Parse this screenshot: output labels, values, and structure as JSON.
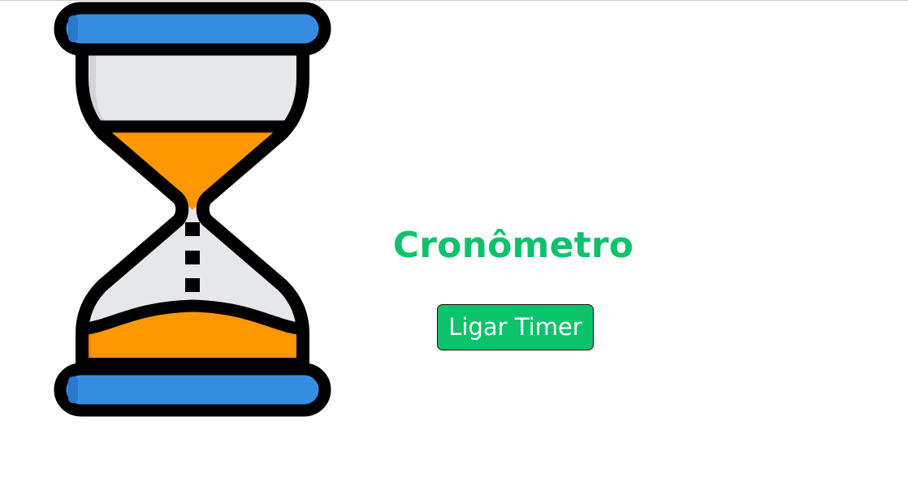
{
  "page": {
    "title": "Cronômetro"
  },
  "controls": {
    "start_button_label": "Ligar Timer"
  },
  "icons": {
    "hero": "hourglass-icon"
  },
  "colors": {
    "accent": "#0cc36b",
    "hourglass_caps": "#368ee3",
    "hourglass_sand": "#ff9700",
    "hourglass_glass": "#e6e7e9",
    "outline": "#000000"
  }
}
